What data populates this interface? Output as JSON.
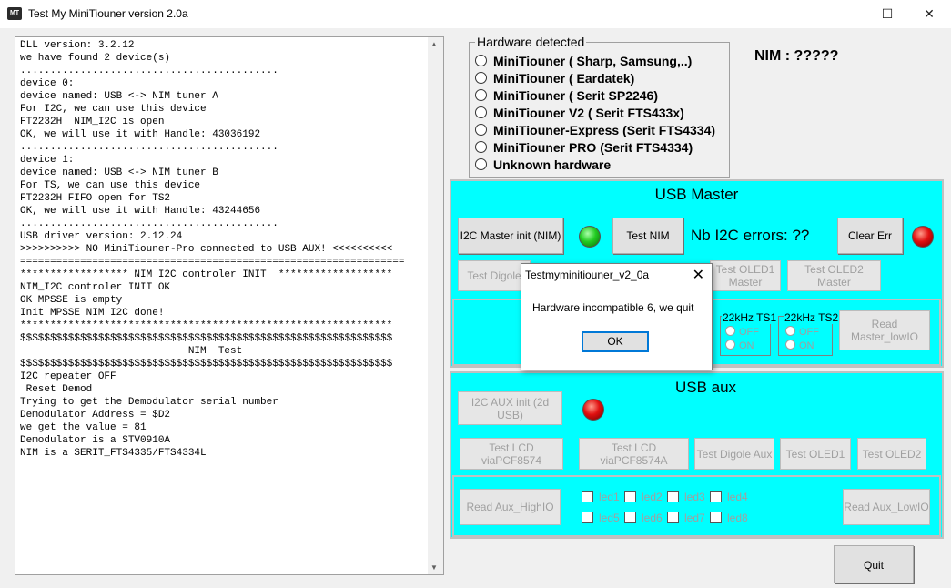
{
  "window": {
    "title": "Test My MiniTiouner version 2.0a",
    "app_icon_text": "MT",
    "controls": {
      "minimize": "—",
      "maximize": "☐",
      "close": "✕"
    }
  },
  "log": {
    "lines": [
      "DLL version: 3.2.12",
      "we have found 2 device(s)",
      "...........................................",
      "device 0:",
      "device named: USB <-> NIM tuner A",
      "For I2C, we can use this device",
      "FT2232H  NIM_I2C is open",
      "OK, we will use it with Handle: 43036192",
      "...........................................",
      "device 1:",
      "device named: USB <-> NIM tuner B",
      "For TS, we can use this device",
      "FT2232H FIFO open for TS2",
      "OK, we will use it with Handle: 43244656",
      "...........................................",
      "USB driver version: 2.12.24",
      ">>>>>>>>>> NO MiniTiouner-Pro connected to USB AUX! <<<<<<<<<<",
      "================================================================",
      "****************** NIM I2C controler INIT  *******************",
      "NIM_I2C controler INIT OK",
      "OK MPSSE is empty",
      "Init MPSSE NIM I2C done!",
      "**************************************************************",
      "$$$$$$$$$$$$$$$$$$$$$$$$$$$$$$$$$$$$$$$$$$$$$$$$$$$$$$$$$$$$$$",
      "                            NIM  Test",
      "$$$$$$$$$$$$$$$$$$$$$$$$$$$$$$$$$$$$$$$$$$$$$$$$$$$$$$$$$$$$$$",
      "I2C repeater OFF",
      " Reset Demod",
      "Trying to get the Demodulator serial number",
      "Demodulator Address = $D2",
      "we get the value = 81",
      "Demodulator is a STV0910A",
      "NIM is a SERIT_FTS4335/FTS4334L"
    ],
    "scroll_up": "▲",
    "scroll_down": "▼"
  },
  "hardware": {
    "title": "Hardware detected",
    "options": [
      "MiniTiouner ( Sharp, Samsung,..)",
      "MiniTiouner ( Eardatek)",
      "MiniTiouner ( Serit SP2246)",
      "MiniTiouner V2 ( Serit FTS433x)",
      "MiniTiouner-Express (Serit FTS4334)",
      "MiniTiouner PRO  (Serit FTS4334)",
      "Unknown hardware"
    ]
  },
  "nim_label": "NIM : ?????",
  "usb_master": {
    "title": "USB Master",
    "i2c_init": "I2C Master init (NIM)",
    "test_nim": "Test NIM",
    "nb_errors": "Nb I2C errors:  ??",
    "clear_err": "Clear Err",
    "test_digole": "Test Digole",
    "test_oled1": "Test OLED1 Master",
    "test_oled2": "Test OLED2 Master",
    "ts1_title": "22kHz TS1",
    "ts2_title": "22kHz TS2",
    "off": "OFF",
    "on": "ON",
    "read_master": "Read Master_lowIO",
    "led_left_color": "#22cc22",
    "led_right_color": "#e01010"
  },
  "usb_aux": {
    "title": "USB aux",
    "i2c_aux_init": "I2C AUX init (2d USB)",
    "test_lcd1": "Test LCD viaPCF8574",
    "test_lcd2": "Test LCD viaPCF8574A",
    "test_digole_aux": "Test Digole Aux",
    "test_oled1": "Test OLED1",
    "test_oled2": "Test OLED2",
    "read_aux_high": "Read Aux_HighIO",
    "read_aux_low": "Read Aux_LowIO",
    "leds": [
      "led1",
      "led2",
      "led3",
      "led4",
      "led5",
      "led6",
      "led7",
      "led8"
    ]
  },
  "quit": "Quit",
  "dialog": {
    "title": "Testmyminitiouner_v2_0a",
    "message": "Hardware incompatible 6, we quit",
    "ok": "OK",
    "close": "✕"
  }
}
